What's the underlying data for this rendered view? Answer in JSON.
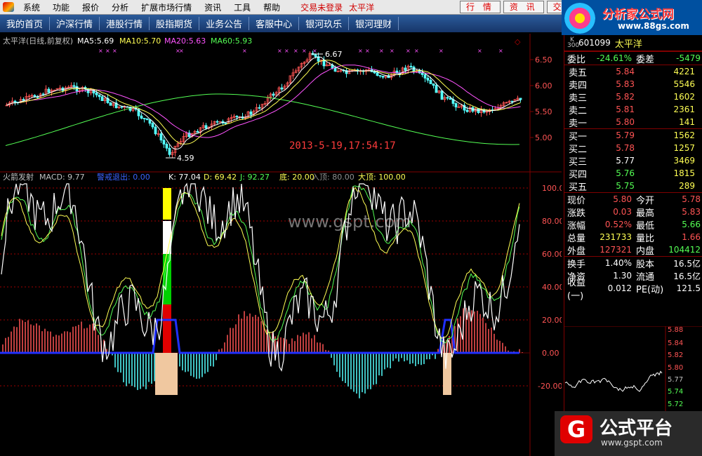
{
  "menubar": {
    "items": [
      "系统",
      "功能",
      "报价",
      "分析",
      "扩展市场行情",
      "资讯",
      "工具",
      "帮助"
    ],
    "status": "交易未登录",
    "stock_short": "太平洋",
    "buttons": [
      "行 情",
      "资 讯",
      "交 易"
    ]
  },
  "brand": {
    "title": "分析家公式网",
    "url": "www.88gs.com"
  },
  "navbar": {
    "items": [
      "我的首页",
      "沪深行情",
      "港股行情",
      "股指期货",
      "业务公告",
      "客服中心",
      "银河玖乐",
      "银河理财"
    ]
  },
  "main_chart": {
    "header": "太平洋(日线,前复权)",
    "ma": [
      {
        "label": "MA5:",
        "value": "5.69",
        "color": "#ffffff"
      },
      {
        "label": "MA10:",
        "value": "5.70",
        "color": "#ffff54"
      },
      {
        "label": "MA20:",
        "value": "5.63",
        "color": "#ff54ff"
      },
      {
        "label": "MA60:",
        "value": "5.93",
        "color": "#54ff54"
      }
    ],
    "high_label": "6.67",
    "low_label": "4.59",
    "timestamp": "2013-5-19,17:54:17",
    "y_ticks": [
      "6.50",
      "6.00",
      "5.50",
      "5.00"
    ],
    "diamond": "◇"
  },
  "indicator": {
    "name": "火箭发射",
    "values": [
      {
        "text": "MACD: 9.77",
        "color": "#c0c0c0"
      },
      {
        "text": "警戒退出: 0.00",
        "color": "#3c64ff"
      },
      {
        "text": "K: 77.04",
        "color": "#ffffff"
      },
      {
        "text": "D: 69.42",
        "color": "#ffff54"
      },
      {
        "text": "J: 92.27",
        "color": "#54ff54"
      },
      {
        "text": "底: 20.00",
        "color": "#ffff54"
      },
      {
        "text": "入顶: 80.00",
        "color": "#909090"
      },
      {
        "text": "大顶: 100.00",
        "color": "#ffff54"
      }
    ],
    "y_ticks": [
      "100.00",
      "80.00",
      "60.00",
      "40.00",
      "20.00",
      "0.00",
      "-20.00"
    ],
    "watermark": "www.gspt.com"
  },
  "quote": {
    "code": "601099",
    "name": "太平洋",
    "k_label": "K 300",
    "webi": {
      "label": "委比",
      "value": "-24.61%",
      "label2": "委差",
      "value2": "-5479"
    },
    "asks": [
      {
        "label": "卖五",
        "price": "5.84",
        "vol": "4221"
      },
      {
        "label": "卖四",
        "price": "5.83",
        "vol": "5546"
      },
      {
        "label": "卖三",
        "price": "5.82",
        "vol": "1602"
      },
      {
        "label": "卖二",
        "price": "5.81",
        "vol": "2361"
      },
      {
        "label": "卖一",
        "price": "5.80",
        "vol": "141"
      }
    ],
    "bids": [
      {
        "label": "买一",
        "price": "5.79",
        "vol": "1562"
      },
      {
        "label": "买二",
        "price": "5.78",
        "vol": "1257"
      },
      {
        "label": "买三",
        "price": "5.77",
        "vol": "3469"
      },
      {
        "label": "买四",
        "price": "5.76",
        "vol": "1815"
      },
      {
        "label": "买五",
        "price": "5.75",
        "vol": "289"
      }
    ],
    "stats": [
      {
        "l1": "现价",
        "v1": "5.80",
        "c1": "red",
        "l2": "今开",
        "v2": "5.78",
        "c2": "red"
      },
      {
        "l1": "涨跌",
        "v1": "0.03",
        "c1": "red",
        "l2": "最高",
        "v2": "5.83",
        "c2": "red"
      },
      {
        "l1": "涨幅",
        "v1": "0.52%",
        "c1": "red",
        "l2": "最低",
        "v2": "5.66",
        "c2": "grn"
      },
      {
        "l1": "总量",
        "v1": "231733",
        "c1": "yel",
        "l2": "量比",
        "v2": "1.66",
        "c2": "red"
      },
      {
        "l1": "外盘",
        "v1": "127321",
        "c1": "red",
        "l2": "内盘",
        "v2": "104412",
        "c2": "grn"
      },
      {
        "l1": "换手",
        "v1": "1.40%",
        "c1": "wht",
        "l2": "股本",
        "v2": "16.5亿",
        "c2": "wht"
      },
      {
        "l1": "净资",
        "v1": "1.30",
        "c1": "wht",
        "l2": "流通",
        "v2": "16.5亿",
        "c2": "wht"
      },
      {
        "l1": "收益(一)",
        "v1": "0.012",
        "c1": "wht",
        "l2": "PE(动)",
        "v2": "121.5",
        "c2": "wht"
      }
    ]
  },
  "mini_chart": {
    "y_ticks": [
      "5.88",
      "5.84",
      "5.82",
      "5.80",
      "5.77",
      "5.74",
      "5.72"
    ]
  },
  "gongshi": {
    "logo": "G",
    "title": "公式平台",
    "url": "www.gspt.com"
  },
  "colors": {
    "up": "#ff5454",
    "down": "#54ffff",
    "bg": "#000000",
    "grid": "#800000",
    "kdj_k": "#ffffff",
    "kdj_d": "#ffff54",
    "kdj_j": "#54ff54",
    "alert": "#2030ff"
  }
}
